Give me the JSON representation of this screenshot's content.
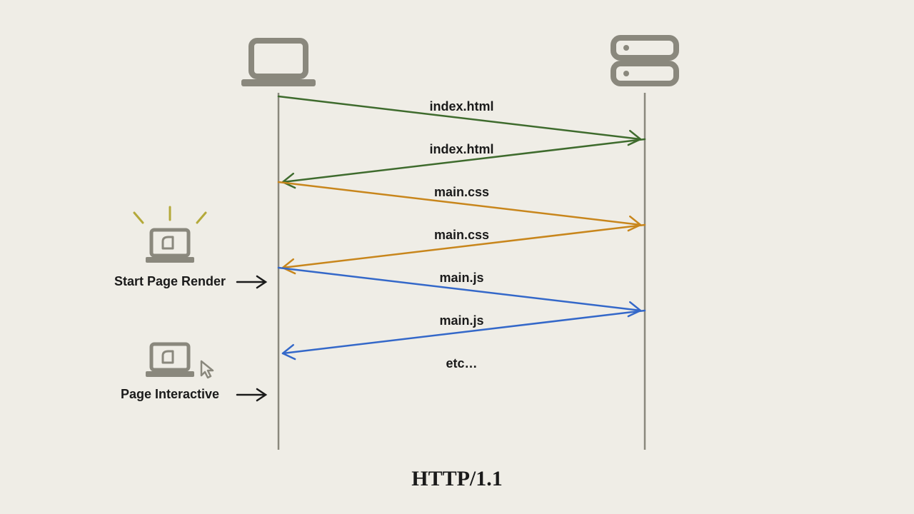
{
  "title": "HTTP/1.1",
  "colors": {
    "green": "#3e6b2d",
    "orange": "#c8861c",
    "blue": "#3468c9",
    "gray": "#8a887d",
    "lifeline": "#8a887d",
    "sparkle": "#b4a93a",
    "black": "#1a1a1a"
  },
  "messages": [
    {
      "label": "index.html",
      "color_key": "green"
    },
    {
      "label": "index.html",
      "color_key": "green"
    },
    {
      "label": "main.css",
      "color_key": "orange"
    },
    {
      "label": "main.css",
      "color_key": "orange"
    },
    {
      "label": "main.js",
      "color_key": "blue"
    },
    {
      "label": "main.js",
      "color_key": "blue"
    },
    {
      "label": "etc…",
      "color_key": null
    }
  ],
  "milestones": [
    {
      "label": "Start Page Render"
    },
    {
      "label": "Page Interactive"
    }
  ]
}
